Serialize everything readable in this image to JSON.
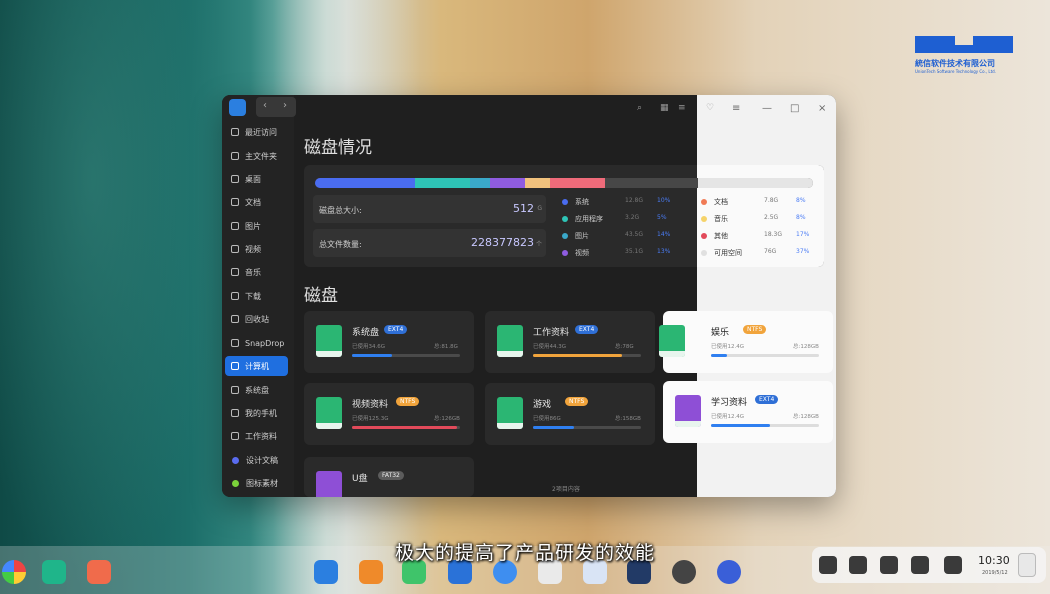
{
  "brand": {
    "name": "統信软件技术有限公司",
    "sub": "UnionTech Software Technology Co., Ltd."
  },
  "sidebar": {
    "items": [
      {
        "label": "最近访问"
      },
      {
        "label": "主文件夹"
      },
      {
        "label": "桌面"
      },
      {
        "label": "文档"
      },
      {
        "label": "图片"
      },
      {
        "label": "视频"
      },
      {
        "label": "音乐"
      },
      {
        "label": "下载"
      },
      {
        "label": "回收站"
      },
      {
        "label": "SnapDrop"
      },
      {
        "label": "计算机"
      },
      {
        "label": "系统盘"
      },
      {
        "label": "我的手机"
      },
      {
        "label": "工作资料"
      },
      {
        "label": "设计文稿"
      },
      {
        "label": "图标素材"
      }
    ],
    "active": "计算机"
  },
  "disk_overview": {
    "title": "磁盘情况",
    "total_size_label": "磁盘总大小:",
    "total_size_value": "512",
    "total_size_unit": "G",
    "file_count_label": "总文件数量:",
    "file_count_value": "228377823",
    "file_count_unit": "个",
    "usage_bar": [
      {
        "name": "系统",
        "color": "#4a6cf0",
        "fraction": 0.2
      },
      {
        "name": "应用程序",
        "color": "#2ec4b6",
        "fraction": 0.11
      },
      {
        "name": "图片",
        "color": "#3aa8c9",
        "fraction": 0.04
      },
      {
        "name": "视频",
        "color": "#8f5ce0",
        "fraction": 0.07
      },
      {
        "name": "文档",
        "color": "#f1c27d",
        "fraction": 0.05
      },
      {
        "name": "音乐",
        "color": "#ef6b7a",
        "fraction": 0.11
      }
    ],
    "legend_left": [
      {
        "name": "系统",
        "size": "12.8G",
        "pct": "10%",
        "color": "#4a6cf0"
      },
      {
        "name": "应用程序",
        "size": "3.2G",
        "pct": "5%",
        "color": "#2ec4b6"
      },
      {
        "name": "图片",
        "size": "43.5G",
        "pct": "14%",
        "color": "#3aa8c9"
      },
      {
        "name": "视频",
        "size": "35.1G",
        "pct": "13%",
        "color": "#8f5ce0"
      }
    ],
    "legend_right": [
      {
        "name": "文档",
        "size": "7.8G",
        "pct": "8%",
        "color": "#f07a55"
      },
      {
        "name": "音乐",
        "size": "2.5G",
        "pct": "8%",
        "color": "#f5d36a"
      },
      {
        "name": "其他",
        "size": "18.3G",
        "pct": "17%",
        "color": "#e24a5a"
      },
      {
        "name": "可用空间",
        "size": "76G",
        "pct": "37%",
        "color": "#e0e0e0"
      }
    ]
  },
  "disks": {
    "title": "磁盘",
    "cards": [
      {
        "name": "系统盘",
        "fs": "EXT4",
        "used": "已使用34.6G",
        "total": "总:81.8G",
        "fraction": 0.37,
        "bar_color": "#2f7ff0"
      },
      {
        "name": "工作资料",
        "fs": "EXT4",
        "used": "已使用44.3G",
        "total": "总:78G",
        "fraction": 0.82,
        "bar_color": "#f1a43c"
      },
      {
        "name": "娱乐",
        "fs": "NTFS",
        "used": "已使用12.4G",
        "total": "总:128GB",
        "fraction": 0.15,
        "bar_color": "#2f7ff0"
      },
      {
        "name": "视频资料",
        "fs": "NTFS",
        "used": "已使用125.3G",
        "total": "总:126GB",
        "fraction": 0.97,
        "bar_color": "#e24a5a"
      },
      {
        "name": "游戏",
        "fs": "NTFS",
        "used": "已使用86G",
        "total": "总:158GB",
        "fraction": 0.38,
        "bar_color": "#2f7ff0"
      },
      {
        "name": "学习资料",
        "fs": "EXT4",
        "used": "已使用12.4G",
        "total": "总:128GB",
        "fraction": 0.55,
        "bar_color": "#2f7ff0"
      },
      {
        "name": "U盘",
        "fs": "FAT32",
        "used": "",
        "total": "",
        "fraction": 0,
        "bar_color": "#2f7ff0"
      }
    ]
  },
  "status": {
    "text": "2项目内容"
  },
  "subtitle": "极大的提高了产品研发的效能",
  "clock": {
    "time": "10:30",
    "date": "2019/5/12"
  },
  "colors": {
    "accent": "#1f6fe0",
    "window_dark": "#1f1f1f",
    "panel_dark": "#2a2a2a"
  }
}
